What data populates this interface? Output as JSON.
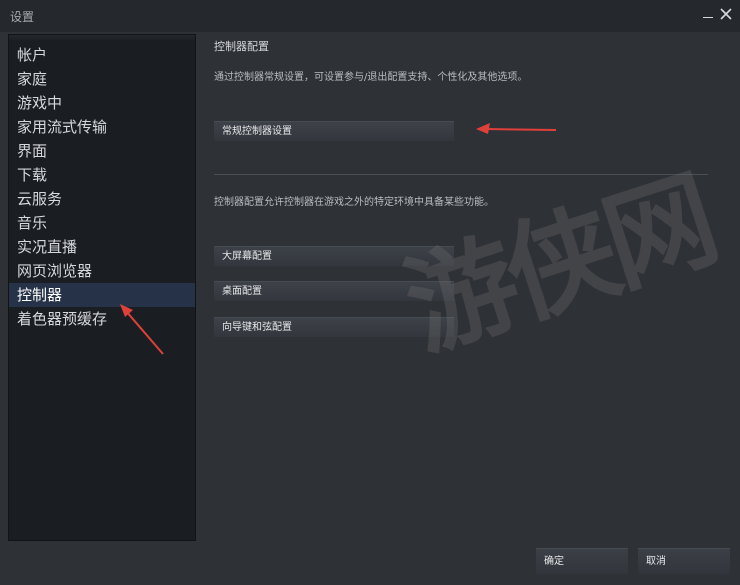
{
  "window": {
    "title": "设置"
  },
  "sidebar": {
    "items": [
      {
        "label": "帐户"
      },
      {
        "label": "家庭"
      },
      {
        "label": "游戏中"
      },
      {
        "label": "家用流式传输"
      },
      {
        "label": "界面"
      },
      {
        "label": "下载"
      },
      {
        "label": "云服务"
      },
      {
        "label": "音乐"
      },
      {
        "label": "实况直播"
      },
      {
        "label": "网页浏览器"
      },
      {
        "label": "控制器",
        "active": true
      },
      {
        "label": "着色器预缓存"
      }
    ]
  },
  "main": {
    "section_title": "控制器配置",
    "intro_text": "通过控制器常规设置，可设置参与/退出配置支持、个性化及其他选项。",
    "general_button": "常规控制器设置",
    "config_text": "控制器配置允许控制器在游戏之外的特定环境中具备某些功能。",
    "config_buttons": [
      "大屏幕配置",
      "桌面配置",
      "向导键和弦配置"
    ]
  },
  "footer": {
    "ok_label": "确定",
    "cancel_label": "取消"
  },
  "watermark": {
    "text": "游侠网"
  },
  "colors": {
    "annotation_arrow": "#e0403a",
    "active_item_bg": "#253248"
  }
}
